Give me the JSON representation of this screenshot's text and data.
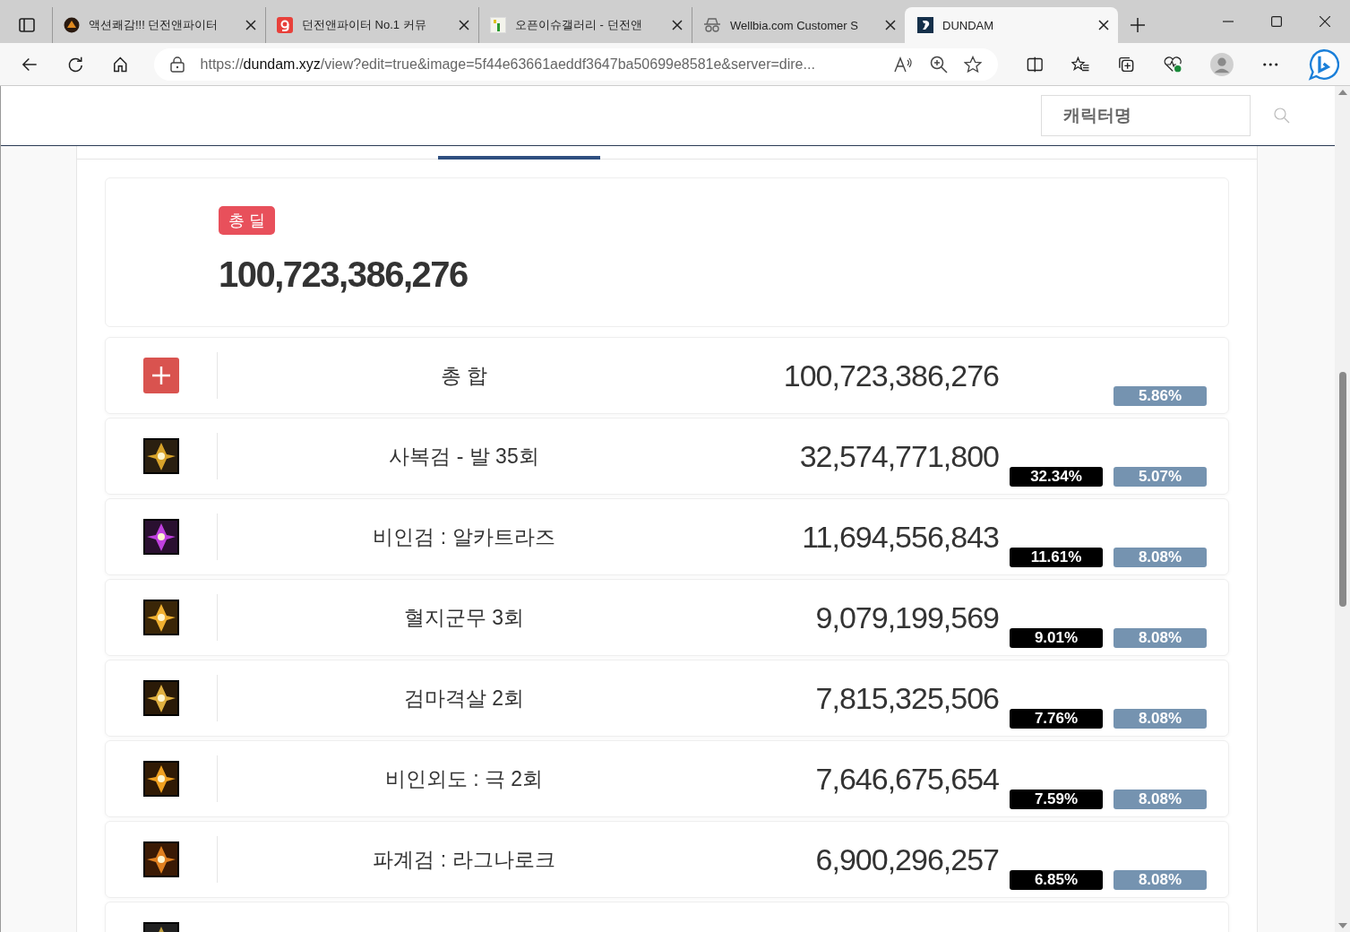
{
  "browser": {
    "tabs": [
      {
        "title": "액션쾌감!!! 던전앤파이터",
        "kind": "df",
        "selected": false
      },
      {
        "title": "던전앤파이터 No.1 커뮤",
        "kind": "g",
        "selected": false
      },
      {
        "title": "오픈이슈갤러리 - 던전앤",
        "kind": "gallery",
        "selected": false
      },
      {
        "title": "Wellbia.com Customer S",
        "kind": "incognito",
        "selected": false
      },
      {
        "title": "DUNDAM",
        "kind": "dundam",
        "selected": true
      }
    ],
    "url": {
      "scheme": "https://",
      "host": "dundam.xyz",
      "path": "/view?edit=true&image=5f44e63661aeddf3647ba50699e8581e&server=dire..."
    }
  },
  "header": {
    "search": {
      "placeholder": "캐릭터명"
    }
  },
  "total": {
    "badge": "총 딜",
    "value": "100,723,386,276"
  },
  "rows": [
    {
      "kind": "total",
      "name": "총 합",
      "damage": "100,723,386,276",
      "rate": "5.86%"
    },
    {
      "kind": "skill",
      "name": "사복검 - 발 35회",
      "damage": "32,574,771,800",
      "share": "32.34%",
      "rate": "5.07%"
    },
    {
      "kind": "skill",
      "name": "비인검 : 알카트라즈",
      "damage": "11,694,556,843",
      "share": "11.61%",
      "rate": "8.08%"
    },
    {
      "kind": "skill",
      "name": "혈지군무 3회",
      "damage": "9,079,199,569",
      "share": "9.01%",
      "rate": "8.08%"
    },
    {
      "kind": "skill",
      "name": "검마격살 2회",
      "damage": "7,815,325,506",
      "share": "7.76%",
      "rate": "8.08%"
    },
    {
      "kind": "skill",
      "name": "비인외도 : 극 2회",
      "damage": "7,646,675,654",
      "share": "7.59%",
      "rate": "8.08%"
    },
    {
      "kind": "skill",
      "name": "파계검 : 라그나로크",
      "damage": "6,900,296,257",
      "share": "6.85%",
      "rate": "8.08%"
    },
    {
      "kind": "skill"
    }
  ]
}
